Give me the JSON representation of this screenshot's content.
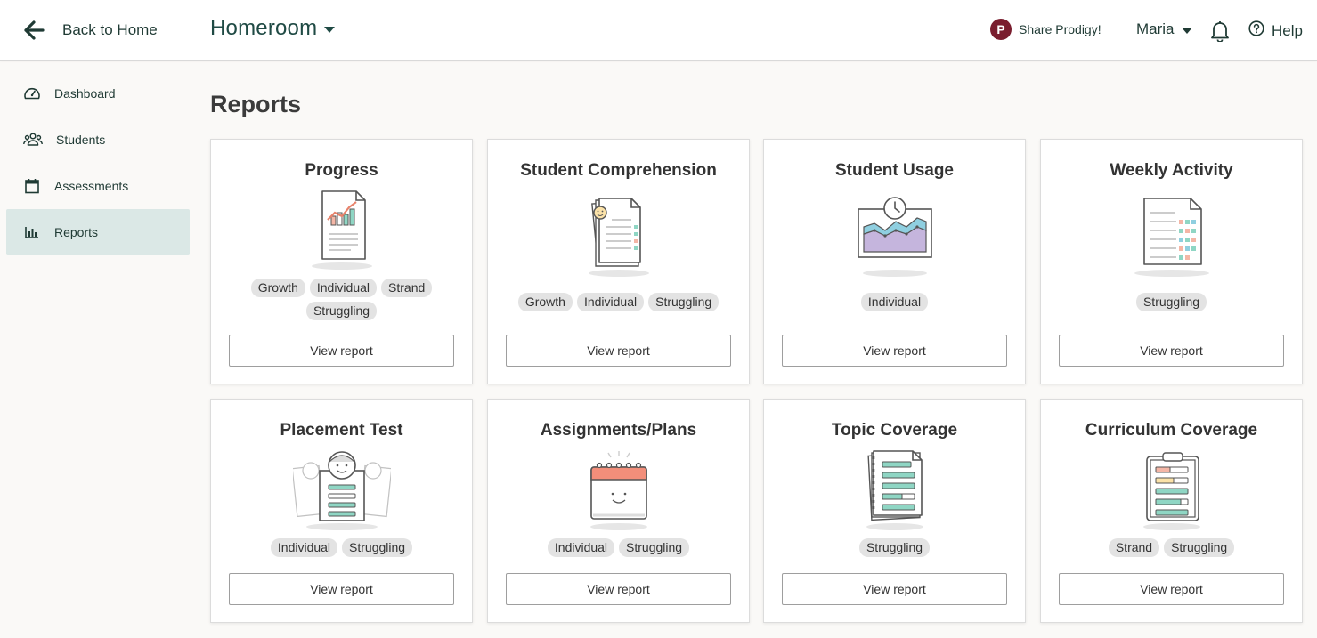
{
  "header": {
    "back_label": "Back to Home",
    "class_name": "Homeroom",
    "share_label": "Share Prodigy!",
    "share_logo": "P",
    "user_name": "Maria",
    "help_label": "Help"
  },
  "sidebar": {
    "items": [
      {
        "label": "Dashboard",
        "icon": "gauge-icon",
        "active": false
      },
      {
        "label": "Students",
        "icon": "people-icon",
        "active": false
      },
      {
        "label": "Assessments",
        "icon": "calendar-icon",
        "active": false
      },
      {
        "label": "Reports",
        "icon": "bar-chart-icon",
        "active": true
      }
    ]
  },
  "main": {
    "title": "Reports",
    "view_label": "View report",
    "cards": [
      {
        "title": "Progress",
        "illustration": "progress-chart-illustration",
        "tags": [
          "Growth",
          "Individual",
          "Strand",
          "Struggling"
        ]
      },
      {
        "title": "Student Comprehension",
        "illustration": "comprehension-document-illustration",
        "tags": [
          "Growth",
          "Individual",
          "Struggling"
        ]
      },
      {
        "title": "Student Usage",
        "illustration": "usage-clock-chart-illustration",
        "tags": [
          "Individual"
        ]
      },
      {
        "title": "Weekly Activity",
        "illustration": "weekly-activity-document-illustration",
        "tags": [
          "Struggling"
        ]
      },
      {
        "title": "Placement Test",
        "illustration": "placement-test-illustration",
        "tags": [
          "Individual",
          "Struggling"
        ]
      },
      {
        "title": "Assignments/Plans",
        "illustration": "calendar-smile-illustration",
        "tags": [
          "Individual",
          "Struggling"
        ]
      },
      {
        "title": "Topic Coverage",
        "illustration": "notebook-illustration",
        "tags": [
          "Struggling"
        ]
      },
      {
        "title": "Curriculum Coverage",
        "illustration": "clipboard-illustration",
        "tags": [
          "Strand",
          "Struggling"
        ]
      }
    ]
  },
  "colors": {
    "brand_dark": "#1f4a44",
    "active_nav_bg": "#dbe8e6",
    "prodigy_logo": "#7a1d2e",
    "tag_bg": "#e3e3e3"
  }
}
